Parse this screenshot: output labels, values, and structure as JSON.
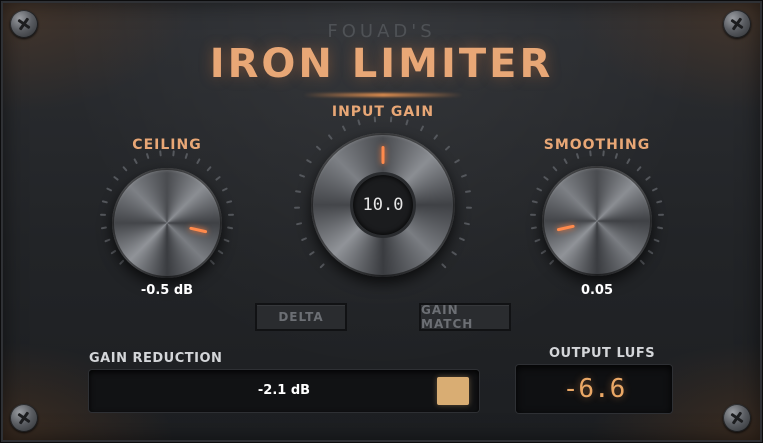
{
  "header": {
    "brand": "FOUAD'S",
    "title": "IRON LIMITER"
  },
  "controls": {
    "ceiling": {
      "label": "CEILING",
      "value": "-0.5 dB",
      "level": 0.88
    },
    "input_gain": {
      "label": "INPUT GAIN",
      "value": "10.0",
      "level": 0.5
    },
    "smoothing": {
      "label": "SMOOTHING",
      "value": "0.05",
      "level": 0.12
    }
  },
  "buttons": {
    "delta": "DELTA",
    "gain_match": "GAIN MATCH"
  },
  "meters": {
    "gain_reduction": {
      "label": "GAIN REDUCTION",
      "value": "-2.1 dB"
    },
    "output_lufs": {
      "label": "OUTPUT LUFS",
      "value": "-6.6"
    }
  },
  "colors": {
    "accent": "#e8a776",
    "pointer": "#ff8a4c",
    "led": "#d9ad73",
    "lufs_digits": "#eba866"
  }
}
